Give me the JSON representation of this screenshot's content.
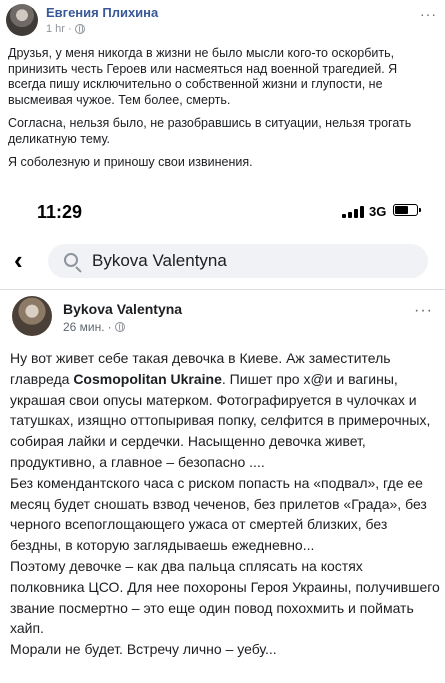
{
  "post": {
    "author": "Евгения Плихина",
    "time": "1 hr",
    "separator": "·",
    "menu": "···",
    "paragraphs": [
      "Друзья, у меня никогда в жизни не было мысли кого-то оскорбить, принизить честь Героев или насмеяться над военной трагедией. Я всегда пишу исключительно о собственной жизни и глупости, не высмеивая чужое. Тем более, смерть.",
      "Согласна, нельзя было, не разобравшись в ситуации, нельзя трогать деликатную тему.",
      "Я соболезную и приношу свои извинения."
    ]
  },
  "screenshot": {
    "status": {
      "time": "11:29",
      "network": "3G"
    },
    "search": {
      "back": "‹",
      "value": "Bykova Valentyna"
    },
    "inner_post": {
      "author": "Bykova Valentyna",
      "time": "26 мин.",
      "separator": "·",
      "menu": "···",
      "text_before_brand": "Ну вот живет себе такая девочка в Киеве. Аж заместитель главреда ",
      "brand": "Cosmopolitan Ukraine",
      "text_after_brand": ". Пишет про х@и и вагины, украшая свои опусы матерком. Фотографируется в чулочках и татушках, изящно оттопыривая попку, селфится в примерочных, собирая лайки и сердечки. Насыщенно девочка живет, продуктивно, а главное – безопасно ....",
      "lines": [
        "Без комендантского часа с риском попасть на «подвал», где ее  месяц будет сношать  взвод чеченов, без прилетов «Града», без черного всепоглощающего ужаса от смертей близких, без бездны, в которую заглядываешь ежедневно...",
        "Поэтому девочке – как два пальца сплясать на костях полковника ЦСО. Для нее похороны Героя Украины, получившего звание посмертно – это еще один повод похохмить и поймать хайп.",
        "Морали не будет. Встречу лично – уебу..."
      ]
    }
  }
}
